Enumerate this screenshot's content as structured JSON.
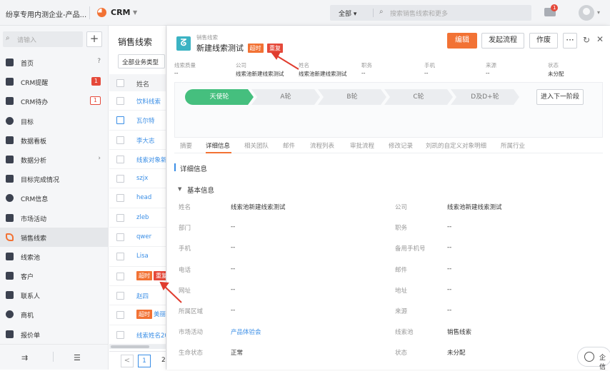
{
  "topbar": {
    "org_name": "纷享专用内测企业-产品...",
    "app_name": "CRM",
    "search_scope": "全部",
    "search_placeholder": "搜索销售线索和更多",
    "mail_badge": "1",
    "icons": [
      "crm-pie-icon",
      "chevron-down-icon",
      "search-icon",
      "mail-icon",
      "avatar"
    ]
  },
  "sidebar": {
    "search_placeholder": "请输入",
    "add_label": "+",
    "items": [
      {
        "label": "首页",
        "icon": "home-icon",
        "right": "?"
      },
      {
        "label": "CRM提醒",
        "icon": "bell-icon",
        "badge": "1"
      },
      {
        "label": "CRM待办",
        "icon": "clipboard-icon",
        "badge_outline": "1"
      },
      {
        "label": "目标",
        "icon": "target-icon"
      },
      {
        "label": "数据看板",
        "icon": "dashboard-icon"
      },
      {
        "label": "数据分析",
        "icon": "analysis-icon",
        "right": "›"
      },
      {
        "label": "目标完成情况",
        "icon": "check-shield-icon"
      },
      {
        "label": "CRM信息",
        "icon": "pie-icon"
      },
      {
        "label": "市场活动",
        "icon": "flag-icon"
      },
      {
        "label": "销售线索",
        "icon": "lead-icon",
        "active": true
      },
      {
        "label": "线索池",
        "icon": "pool-icon"
      },
      {
        "label": "客户",
        "icon": "building-icon"
      },
      {
        "label": "联系人",
        "icon": "person-icon"
      },
      {
        "label": "商机",
        "icon": "opportunity-icon"
      },
      {
        "label": "报价单",
        "icon": "quote-icon"
      }
    ],
    "bottom_left": "⇉",
    "bottom_right": "☰"
  },
  "list": {
    "title": "销售线索",
    "filter": "全部业务类型",
    "column_header": "姓名",
    "rows": [
      {
        "text": "饮料线索"
      },
      {
        "text": "瓦尔特"
      },
      {
        "text": "李大志"
      },
      {
        "text": "线索对象新建"
      },
      {
        "text": "szjx"
      },
      {
        "text": "head"
      },
      {
        "text": "zleb"
      },
      {
        "text": "qwer"
      },
      {
        "text": "Lisa"
      },
      {
        "text": "",
        "tags": [
          "超时",
          "重复"
        ]
      },
      {
        "text": "赵四"
      },
      {
        "text": "美丽",
        "tags": [
          "超时"
        ]
      },
      {
        "text": "线索姓名20"
      }
    ],
    "pager": {
      "prev": "<",
      "current": "1",
      "next": "2"
    }
  },
  "detail": {
    "object_type": "销售线索",
    "title": "新建线索测试",
    "tag_timeout": "超时",
    "tag_duplicate": "重复",
    "buttons": {
      "edit": "编辑",
      "start_flow": "发起流程",
      "void": "作废",
      "more": "···"
    },
    "summary": [
      {
        "k": "线索质量",
        "v": "--"
      },
      {
        "k": "公司",
        "v": "线索池新建线索测试"
      },
      {
        "k": "姓名",
        "v": "线索池新建线索测试"
      },
      {
        "k": "职务",
        "v": "--"
      },
      {
        "k": "手机",
        "v": "--"
      },
      {
        "k": "来源",
        "v": "--"
      },
      {
        "k": "状态",
        "v": "未分配"
      }
    ],
    "stages": [
      "天使轮",
      "A轮",
      "B轮",
      "C轮",
      "D及D+轮"
    ],
    "active_stage": "天使轮",
    "next_stage_button": "进入下一阶段",
    "tabs": [
      "摘要",
      "详细信息",
      "相关团队",
      "邮件",
      "流程列表",
      "审批流程",
      "修改记录",
      "刘凯的自定义对象明细",
      "所属行业"
    ],
    "active_tab": "详细信息",
    "section_title": "详细信息",
    "group_title": "基本信息",
    "fields_left": [
      {
        "k": "姓名",
        "v": "线索池新建线索测试"
      },
      {
        "k": "部门",
        "v": "--"
      },
      {
        "k": "手机",
        "v": "--"
      },
      {
        "k": "电话",
        "v": "--"
      },
      {
        "k": "网址",
        "v": "--"
      },
      {
        "k": "所属区域",
        "v": "--"
      },
      {
        "k": "市场活动",
        "v": "产品体验会",
        "link": true
      },
      {
        "k": "生命状态",
        "v": "正常"
      }
    ],
    "fields_right": [
      {
        "k": "公司",
        "v": "线索池新建线索测试"
      },
      {
        "k": "职务",
        "v": "--"
      },
      {
        "k": "备用手机号",
        "v": "--"
      },
      {
        "k": "邮件",
        "v": "--"
      },
      {
        "k": "地址",
        "v": "--"
      },
      {
        "k": "来源",
        "v": "--"
      },
      {
        "k": "线索池",
        "v": "销售线索"
      },
      {
        "k": "状态",
        "v": "未分配"
      }
    ]
  },
  "float_widget": {
    "label": "企信"
  },
  "colors": {
    "accent": "#f27234",
    "link": "#3a8ee6",
    "stage_active": "#45bf7e",
    "badge_red": "#e5493a",
    "annotation_arrow": "#e03c2e"
  }
}
